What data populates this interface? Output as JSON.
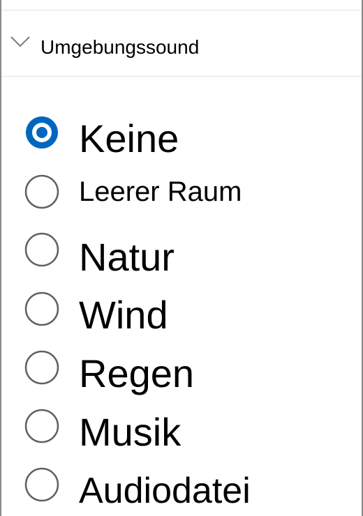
{
  "section": {
    "title": "Umgebungssound",
    "expanded": true
  },
  "colors": {
    "accent": "#0067c0",
    "radio_border": "#606060",
    "divider": "#e4e4e4"
  },
  "options": [
    {
      "label": "Keine",
      "selected": true
    },
    {
      "label": "Leerer Raum",
      "selected": false
    },
    {
      "label": "Natur",
      "selected": false
    },
    {
      "label": "Wind",
      "selected": false
    },
    {
      "label": "Regen",
      "selected": false
    },
    {
      "label": "Musik",
      "selected": false
    },
    {
      "label": "Audiodatei",
      "selected": false
    }
  ]
}
